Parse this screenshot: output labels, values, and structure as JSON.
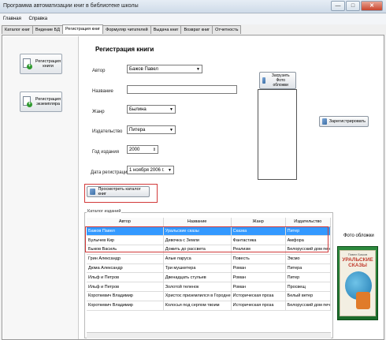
{
  "window": {
    "title": "Программа автоматизации книг в библиотеке школы",
    "btn_min": "—",
    "btn_max": "□",
    "btn_close": "✕"
  },
  "menu": [
    "Главная",
    "Справка"
  ],
  "tabs": [
    "Каталог книг",
    "Ведение БД",
    "Регистрация книг",
    "Формуляр читателей",
    "Выдача книг",
    "Возврат книг",
    "Отчетность"
  ],
  "left_buttons": {
    "reg_book": "Регистрация книги",
    "reg_copy": "Регистрация экземпляра"
  },
  "form": {
    "heading": "Регистрация книги",
    "author_label": "Автор",
    "author_value": "Бажов Павел",
    "title_label": "Название",
    "title_value": "",
    "genre_label": "Жанр",
    "genre_value": "Былина",
    "publisher_label": "Издательство",
    "publisher_value": "Питера",
    "year_label": "Год издания",
    "year_value": "2000",
    "date_label": "Дата регистрации",
    "date_value": "1  ноября  2006 г.",
    "upload_photo": "Загрузить Фото обложки",
    "register": "Зарегистрировать",
    "view_catalog": "Просмотреть каталог книг"
  },
  "catalog": {
    "group_title": "Каталог изданий",
    "columns": [
      "Автор",
      "Название",
      "Жанр",
      "Издательство"
    ],
    "rows": [
      [
        "Бажов Павел",
        "Уральские сказы",
        "Сказка",
        "Питер"
      ],
      [
        "Булычев Кир",
        "Девочка с Земли",
        "Фантастика",
        "Амфора"
      ],
      [
        "Быков Василь",
        "Дожить до рассвета",
        "Реализм",
        "Белорусский дом печ"
      ],
      [
        "Грин Александр",
        "Алые паруса",
        "Повесть",
        "Эксмо"
      ],
      [
        "Дюма Александр",
        "Три мушкетера",
        "Роман",
        "Питера"
      ],
      [
        "Ильф и Петров",
        "Двенадцать стульев",
        "Роман",
        "Питер"
      ],
      [
        "Ильф и Петров",
        "Золотой теленок",
        "Роман",
        "Просвещ"
      ],
      [
        "Короткевич Владимир",
        "Христос приземлился в Городне",
        "Историческая проза",
        "Белый ветер"
      ],
      [
        "Короткевич Владимир",
        "Колосья под серпом твоим",
        "Историческая проза",
        "Белорусский дом печ"
      ]
    ],
    "selected_row": 0
  },
  "cover": {
    "label": "Фото обложки",
    "author": "Павел Бажов",
    "title": "УРАЛЬСКИЕ СКАЗЫ"
  }
}
